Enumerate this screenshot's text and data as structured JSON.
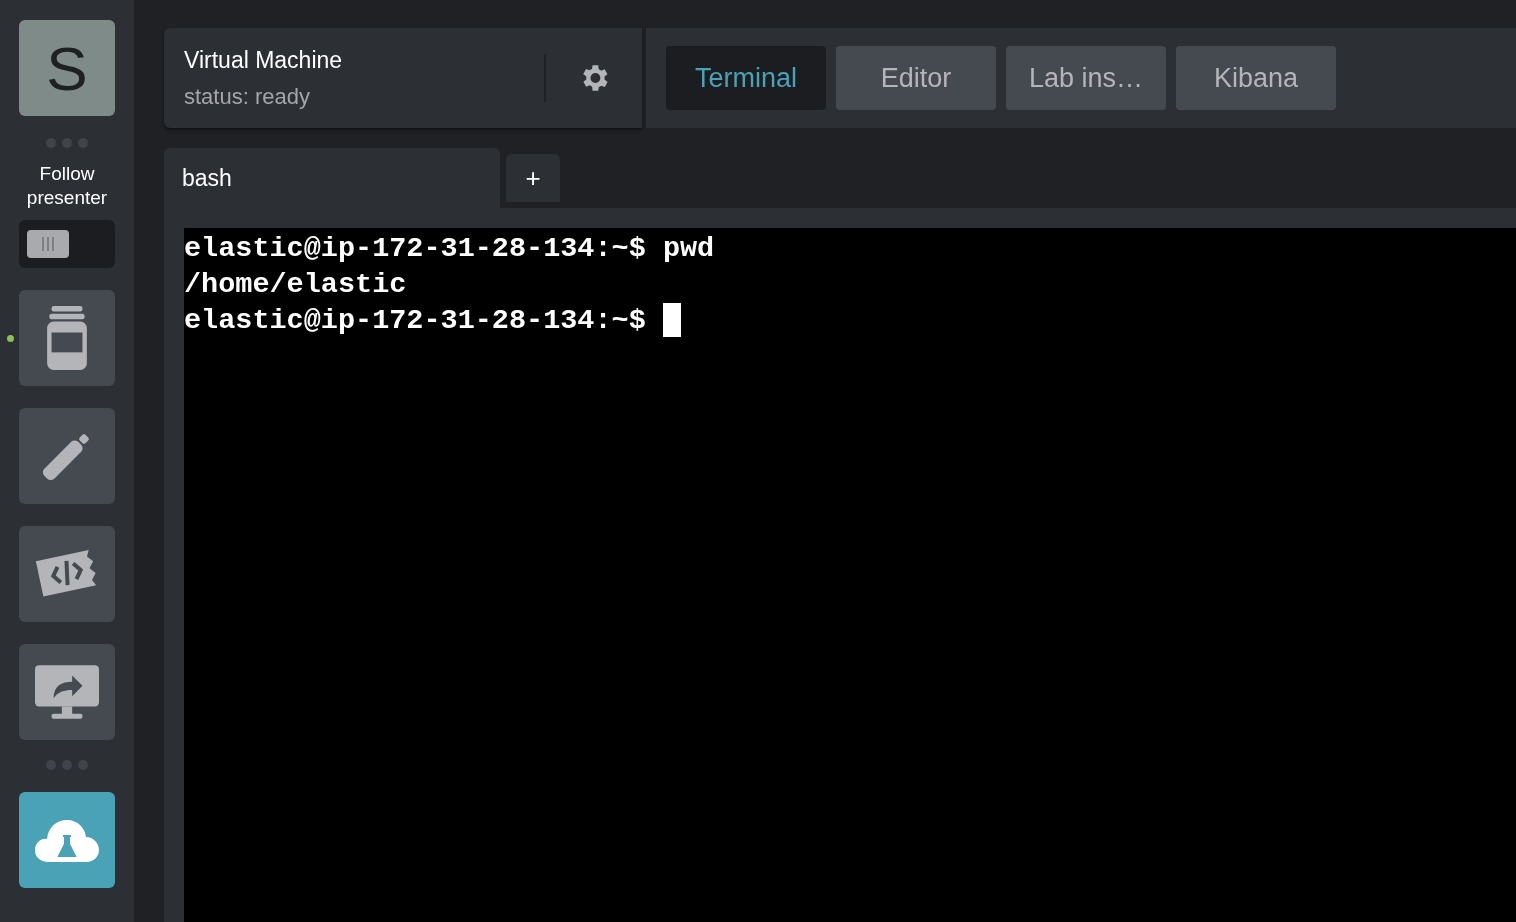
{
  "sidebar": {
    "avatar": "S",
    "follow_label": "Follow presenter",
    "follow_toggle": {
      "on": false
    },
    "tools": [
      {
        "kind": "notes",
        "selected": true
      },
      {
        "kind": "pen",
        "selected": false
      },
      {
        "kind": "code",
        "selected": false
      },
      {
        "kind": "share-screen",
        "selected": false
      }
    ],
    "lab_button": {
      "kind": "cloud-lab"
    }
  },
  "vm": {
    "title": "Virtual Machine",
    "status": "status: ready"
  },
  "tabs": [
    {
      "label": "Terminal",
      "selected": true
    },
    {
      "label": "Editor",
      "selected": false
    },
    {
      "label": "Lab ins…",
      "selected": false
    },
    {
      "label": "Kibana",
      "selected": false
    }
  ],
  "terminal_tabs": [
    {
      "label": "bash"
    }
  ],
  "add_tab": "+",
  "terminal": {
    "lines": [
      "elastic@ip-172-31-28-134:~$ pwd",
      "/home/elastic",
      "elastic@ip-172-31-28-134:~$ "
    ],
    "cursor": true
  }
}
